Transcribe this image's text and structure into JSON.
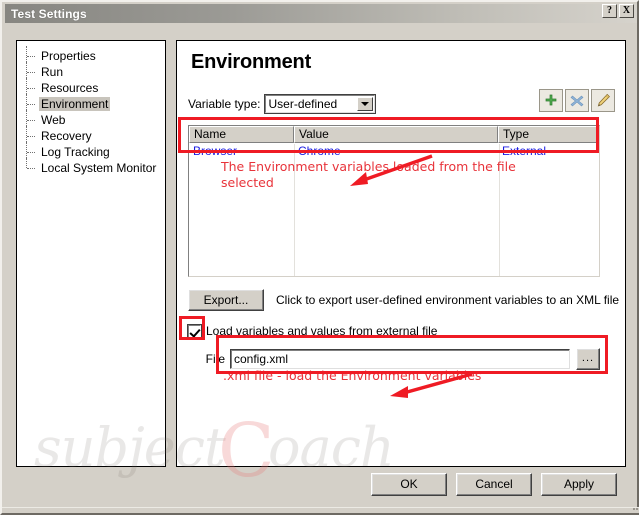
{
  "window": {
    "title": "Test Settings",
    "help_button": "?",
    "close_button": "X"
  },
  "tree": {
    "items": [
      {
        "label": "Properties",
        "selected": false
      },
      {
        "label": "Run",
        "selected": false
      },
      {
        "label": "Resources",
        "selected": false
      },
      {
        "label": "Environment",
        "selected": true
      },
      {
        "label": "Web",
        "selected": false
      },
      {
        "label": "Recovery",
        "selected": false
      },
      {
        "label": "Log Tracking",
        "selected": false
      },
      {
        "label": "Local System Monitor",
        "selected": false
      }
    ]
  },
  "main": {
    "page_title": "Environment",
    "variable_type_label": "Variable type:",
    "variable_type_value": "User-defined",
    "toolbar": {
      "add_title": "add-variable",
      "delete_title": "delete-variable",
      "edit_title": "edit-variable"
    },
    "grid": {
      "columns": [
        "Name",
        "Value",
        "Type"
      ],
      "rows": [
        {
          "name": "Browser",
          "value": "Chrome",
          "type": "External"
        }
      ]
    },
    "export": {
      "button_label": "Export...",
      "help_text": "Click to export user-defined environment variables to an XML file"
    },
    "load_external": {
      "checkbox_label": "Load variables and values from external file",
      "checked": true,
      "file_label": "File",
      "file_value": "config.xml",
      "file_placeholder": "",
      "browse_label": "..."
    }
  },
  "annotations": [
    {
      "text": "The Environment variables loaded from the file selected",
      "color": "#e8333a"
    },
    {
      "text": ".xml file - load the Environment variables",
      "color": "#e8333a"
    }
  ],
  "watermark": {
    "text_left": "subject",
    "text_c": "C",
    "text_right": "oach"
  },
  "buttons": {
    "ok": "OK",
    "cancel": "Cancel",
    "apply": "Apply"
  },
  "colors": {
    "highlight": "#ef1b24",
    "annotation": "#e8333a",
    "grid_value": "#1a1ae0",
    "window_face": "#d4d0c8"
  }
}
